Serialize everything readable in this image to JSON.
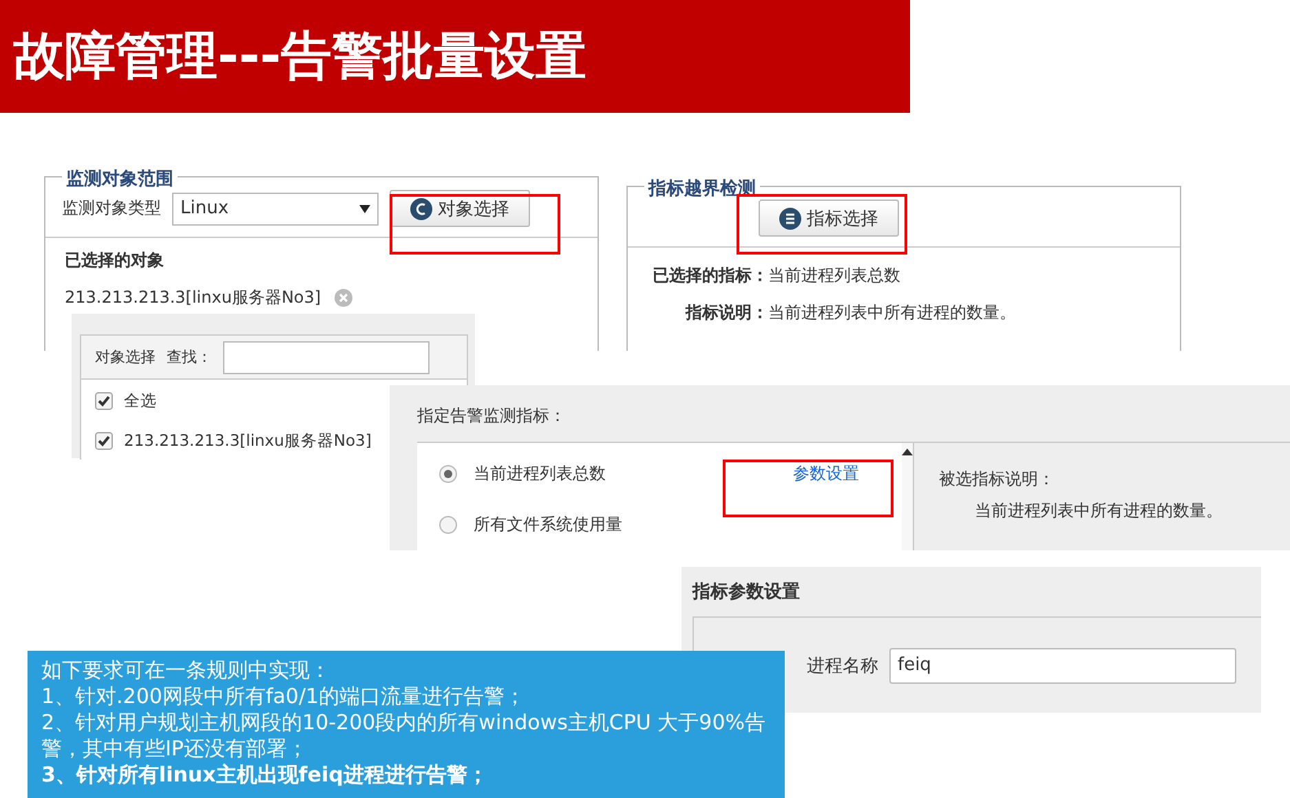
{
  "title": "故障管理---告警批量设置",
  "object_scope": {
    "legend": "监测对象范围",
    "type_label": "监测对象类型",
    "type_value": "Linux",
    "select_button": "对象选择",
    "highlighted": true,
    "selected_heading": "已选择的对象",
    "selected_objects": [
      "213.213.213.3[linxu服务器No3]"
    ]
  },
  "threshold_check": {
    "legend": "指标越界检测",
    "select_button": "指标选择",
    "highlighted": true,
    "selected_label": "已选择的指标：",
    "selected_value": "当前进程列表总数",
    "desc_label": "指标说明：",
    "desc_value": "当前进程列表中所有进程的数量。"
  },
  "object_picker": {
    "title": "对象选择",
    "search_label": "查找：",
    "items": [
      {
        "label": "全选",
        "checked": true
      },
      {
        "label": "213.213.213.3[linxu服务器No3]",
        "checked": true
      }
    ]
  },
  "indicator_picker": {
    "heading": "指定告警监测指标：",
    "options": [
      {
        "label": "当前进程列表总数",
        "selected": true,
        "link": "参数设置",
        "highlighted": true
      },
      {
        "label": "所有文件系统使用量",
        "selected": false
      }
    ],
    "desc_heading": "被选指标说明：",
    "desc_text": "当前进程列表中所有进程的数量。"
  },
  "param_settings": {
    "title": "指标参数设置",
    "field_label": "进程名称",
    "field_value": "feiq"
  },
  "note": {
    "lines": [
      {
        "text": "如下要求可在一条规则中实现：",
        "bold": false
      },
      {
        "text": "1、针对.200网段中所有fa0/1的端口流量进行告警；",
        "bold": false
      },
      {
        "text": "2、针对用户规划主机网段的10-200段内的所有windows主机CPU 大于90%告警，其中有些IP还没有部署；",
        "bold": false
      },
      {
        "text": "3、针对所有linux主机出现feiq进程进行告警；",
        "bold": true
      }
    ]
  }
}
